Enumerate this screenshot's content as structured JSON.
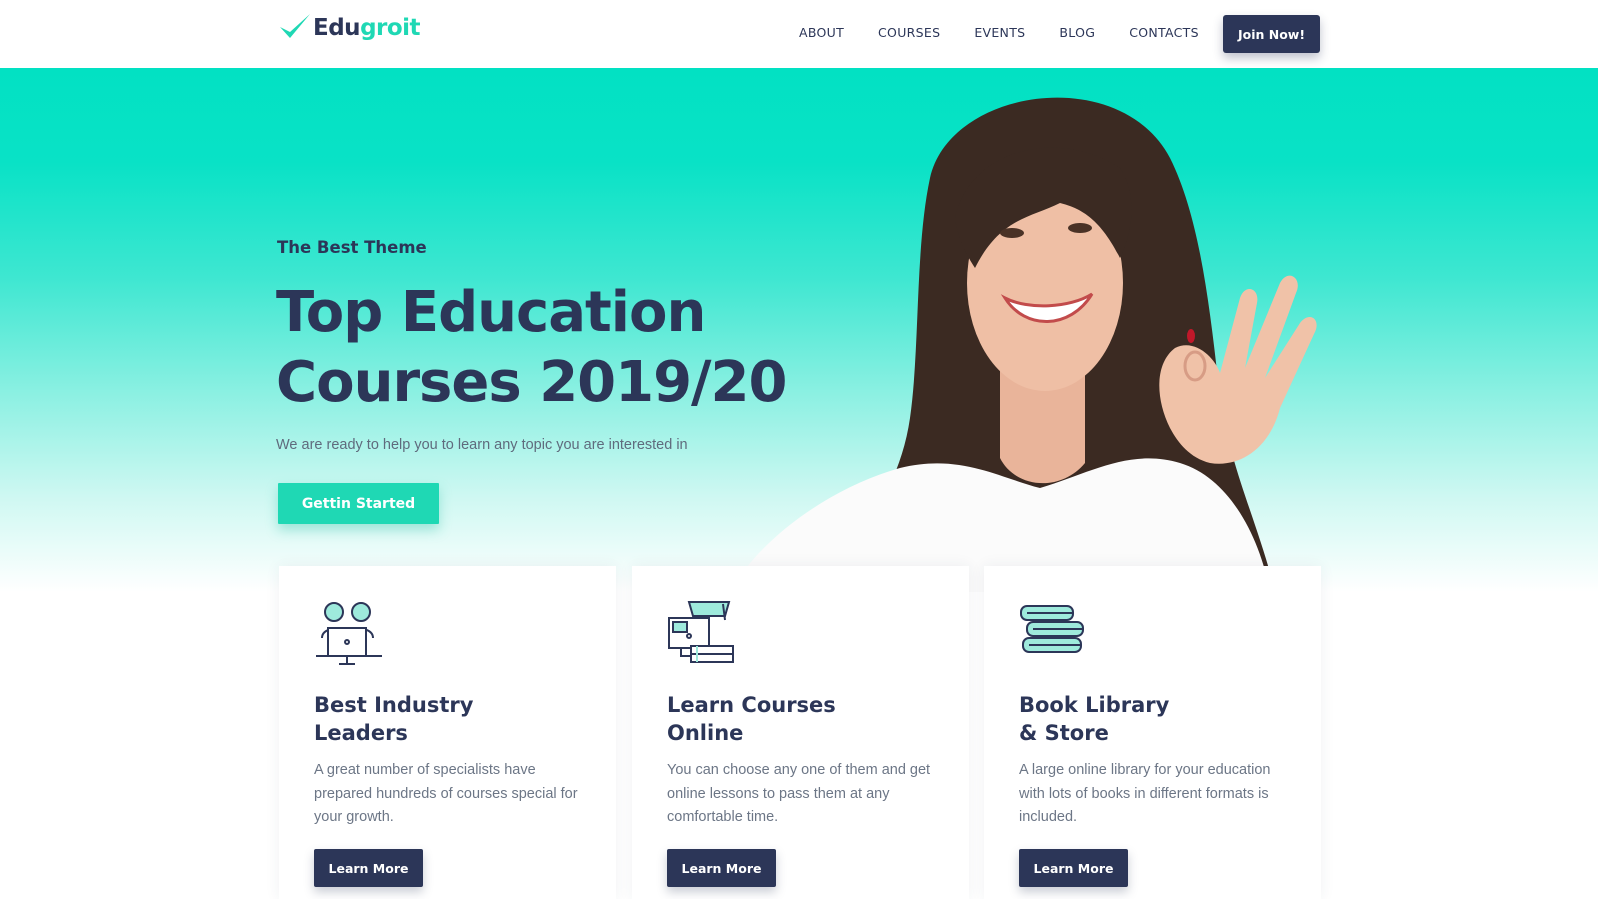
{
  "brand": {
    "name_part1": "Edu",
    "name_part2": "groit",
    "accent_color": "#1fd8b4",
    "primary_color": "#2c3658",
    "icon": "checkmark-icon"
  },
  "nav": {
    "items": [
      "ABOUT",
      "COURSES",
      "EVENTS",
      "BLOG",
      "CONTACTS"
    ],
    "cta_label": "Join Now!"
  },
  "hero": {
    "eyebrow": "The Best Theme",
    "title_line1": "Top Education",
    "title_line2": "Courses 2019/20",
    "subtitle": "We are ready to help you to learn any topic you are interested in",
    "cta_label": "Gettin Started",
    "background_colors": [
      "#02e1c3",
      "#ffffff"
    ]
  },
  "features": [
    {
      "icon": "people-at-computer-icon",
      "title": "Best Industry\nLeaders",
      "text": "A great number of specialists have prepared hundreds of courses special for your growth.",
      "button_label": "Learn More"
    },
    {
      "icon": "online-courses-icon",
      "title": "Learn Courses\nOnline",
      "text": "You can choose any one of them and get online lessons to pass them at any comfortable time.",
      "button_label": "Learn More"
    },
    {
      "icon": "book-stack-icon",
      "title": "Book Library\n& Store",
      "text": "A large online library for your education with lots of books in different formats is included.",
      "button_label": "Learn More"
    }
  ]
}
